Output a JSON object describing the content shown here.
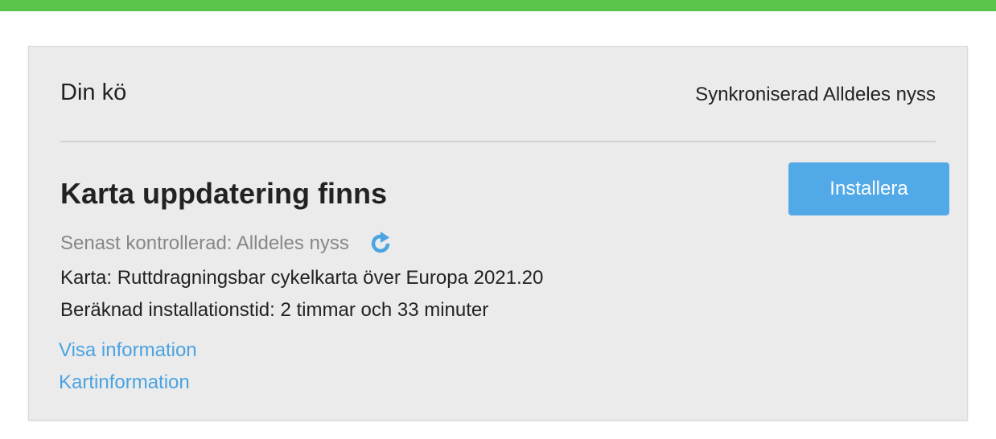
{
  "queue": {
    "title": "Din kö",
    "sync_status": "Synkroniserad Alldeles nyss"
  },
  "update": {
    "title": "Karta uppdatering finns",
    "install_label": "Installera",
    "last_checked": "Senast kontrollerad: Alldeles nyss",
    "map_line": "Karta: Ruttdragningsbar cykelkarta över Europa 2021.20",
    "install_time": "Beräknad installationstid: 2 timmar och 33 minuter",
    "links": {
      "details": "Visa information",
      "map_info": "Kartinformation"
    }
  },
  "colors": {
    "top_bar": "#5ac34a",
    "accent": "#51a9e8",
    "link": "#4aa3e2"
  },
  "icons": {
    "refresh": "refresh-icon"
  }
}
